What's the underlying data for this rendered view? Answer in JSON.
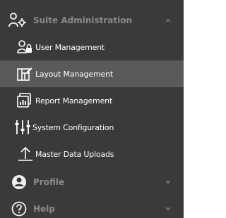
{
  "sidebar": {
    "sections": {
      "suite_admin": {
        "label": "Suite Administration",
        "icon": "user-gear-icon",
        "expanded": true,
        "items": [
          {
            "label": "User Management",
            "icon": "user-lock-icon"
          },
          {
            "label": "Layout Management",
            "icon": "layout-edit-icon",
            "active": true
          },
          {
            "label": "Report Management",
            "icon": "report-chart-icon"
          },
          {
            "label": "System Configuration",
            "icon": "sliders-icon"
          },
          {
            "label": "Master Data Uploads",
            "icon": "upload-arrow-icon"
          }
        ]
      },
      "profile": {
        "label": "Profile",
        "icon": "user-circle-icon",
        "expanded": false
      },
      "help": {
        "label": "Help",
        "icon": "question-circle-icon",
        "expanded": false
      }
    }
  },
  "colors": {
    "sidebar_bg": "#3a3a3a",
    "active_item_bg": "#5a5a5a",
    "header_text": "#8a8a8a",
    "item_text": "#ffffff"
  }
}
